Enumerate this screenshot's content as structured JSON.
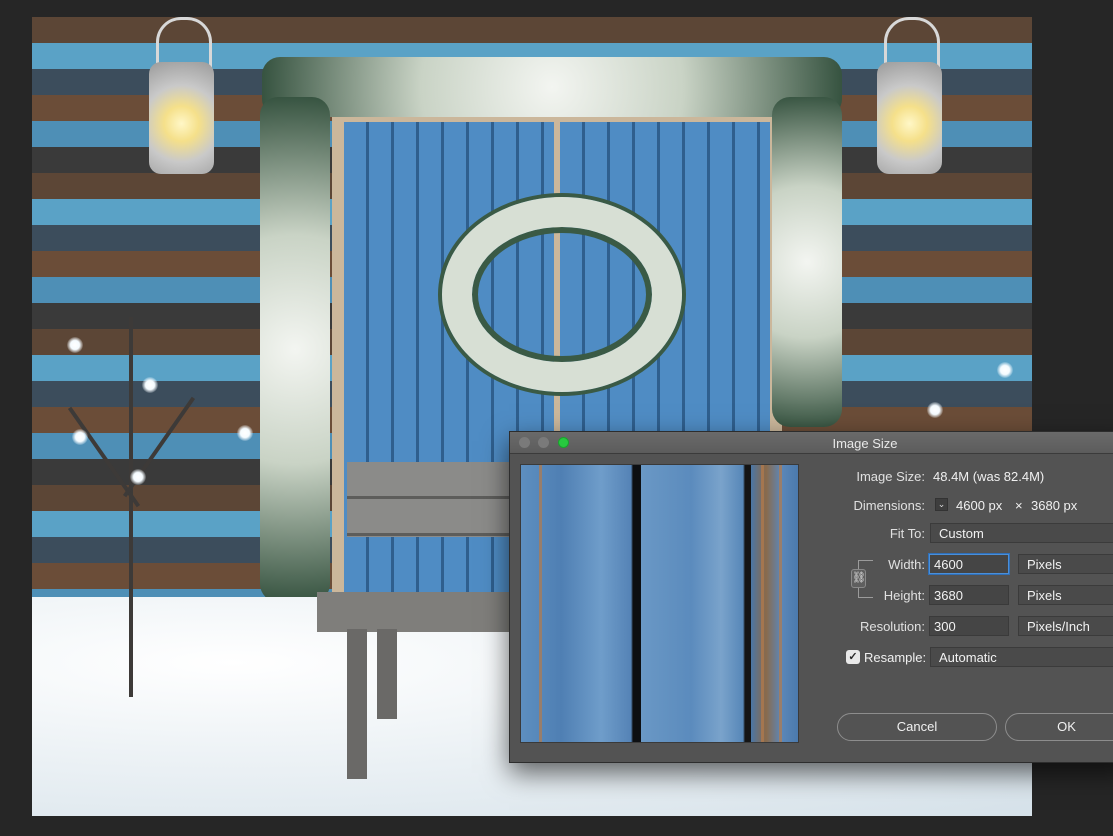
{
  "dialog": {
    "title": "Image Size",
    "image_size_label": "Image Size:",
    "image_size_value": "48.4M (was 82.4M)",
    "dimensions_label": "Dimensions:",
    "dimensions_width": "4600 px",
    "dimensions_times": "×",
    "dimensions_height": "3680 px",
    "fit_to_label": "Fit To:",
    "fit_to_value": "Custom",
    "width_label": "Width:",
    "width_value": "4600",
    "width_unit": "Pixels",
    "height_label": "Height:",
    "height_value": "3680",
    "height_unit": "Pixels",
    "resolution_label": "Resolution:",
    "resolution_value": "300",
    "resolution_unit": "Pixels/Inch",
    "resample_label": "Resample:",
    "resample_checked": true,
    "resample_value": "Automatic",
    "cancel_label": "Cancel",
    "ok_label": "OK",
    "dimensions_toggle_icon": "chevron-down-icon",
    "constrain_icon": "chain-link-icon",
    "check_glyph": "✓",
    "link_glyph": "⛓",
    "toggle_glyph": "⌄"
  }
}
